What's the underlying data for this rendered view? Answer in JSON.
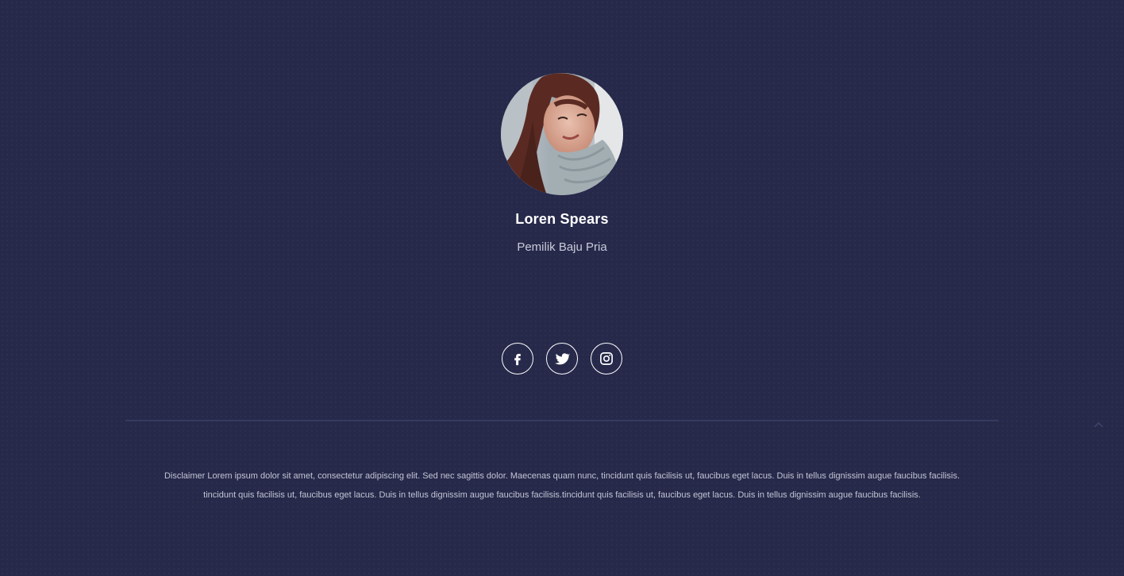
{
  "profile": {
    "name": "Loren Spears",
    "role": "Pemilik Baju Pria",
    "avatar_icon": "profile-photo"
  },
  "social": [
    {
      "network": "facebook",
      "icon": "facebook-icon"
    },
    {
      "network": "twitter",
      "icon": "twitter-icon"
    },
    {
      "network": "instagram",
      "icon": "instagram-icon"
    }
  ],
  "footer": {
    "disclaimer_line1": "Disclaimer Lorem ipsum dolor sit amet, consectetur adipiscing elit. Sed nec sagittis dolor. Maecenas quam nunc, tincidunt quis facilisis ut, faucibus eget lacus. Duis in tellus dignissim augue faucibus facilisis.",
    "disclaimer_line2": "tincidunt quis facilisis ut, faucibus eget lacus. Duis in tellus dignissim augue faucibus facilisis.tincidunt quis facilisis ut, faucibus eget lacus. Duis in tellus dignissim augue faucibus facilisis.",
    "back_to_top_icon": "chevron-up-icon"
  },
  "colors": {
    "background": "#26294a",
    "text_primary": "#ffffff",
    "text_secondary": "#c9cbd8",
    "divider": "#363a5e"
  }
}
